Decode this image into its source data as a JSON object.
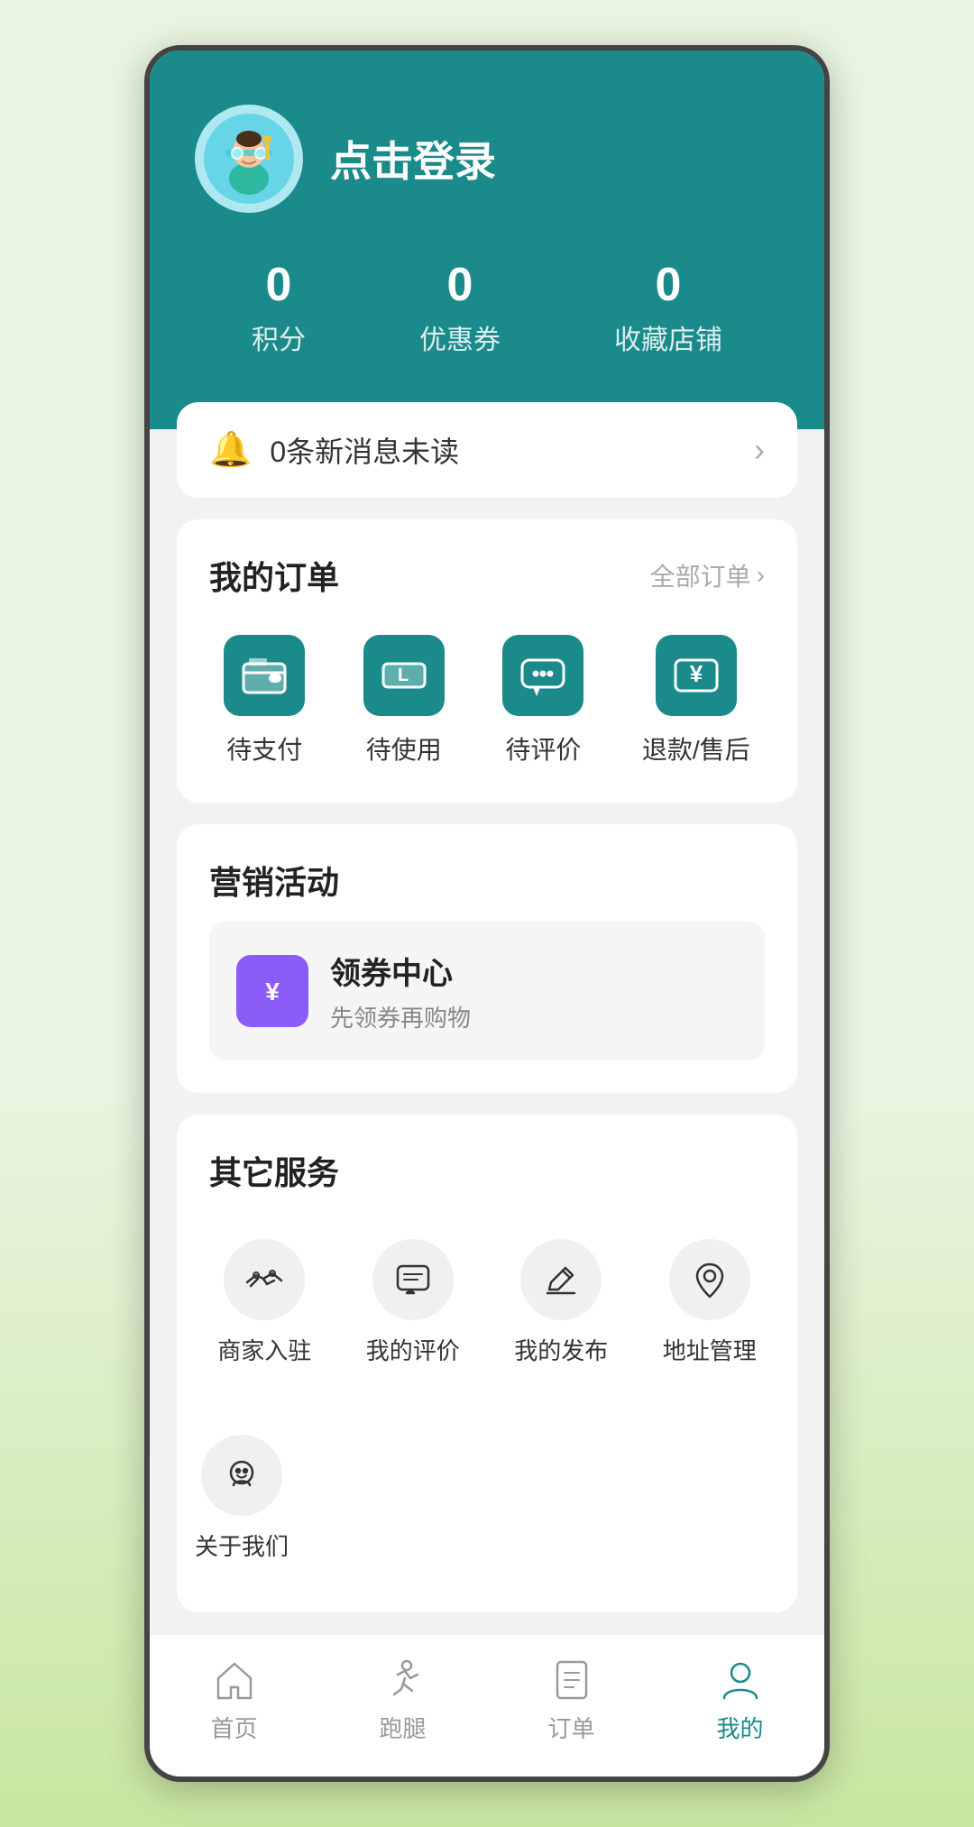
{
  "header": {
    "login_text": "点击登录",
    "stats": [
      {
        "number": "0",
        "label": "积分"
      },
      {
        "number": "0",
        "label": "优惠券"
      },
      {
        "number": "0",
        "label": "收藏店铺"
      }
    ]
  },
  "notification": {
    "text": "0条新消息未读"
  },
  "orders": {
    "title": "我的订单",
    "all_link": "全部订单",
    "items": [
      {
        "label": "待支付"
      },
      {
        "label": "待使用"
      },
      {
        "label": "待评价"
      },
      {
        "label": "退款/售后"
      }
    ]
  },
  "marketing": {
    "title": "营销活动",
    "coupon": {
      "title": "领券中心",
      "subtitle": "先领券再购物"
    }
  },
  "services": {
    "title": "其它服务",
    "items": [
      {
        "label": "商家入驻"
      },
      {
        "label": "我的评价"
      },
      {
        "label": "我的发布"
      },
      {
        "label": "地址管理"
      },
      {
        "label": "关于我们"
      }
    ]
  },
  "bottom_nav": {
    "items": [
      {
        "label": "首页",
        "active": false
      },
      {
        "label": "跑腿",
        "active": false
      },
      {
        "label": "订单",
        "active": false
      },
      {
        "label": "我的",
        "active": true
      }
    ]
  }
}
